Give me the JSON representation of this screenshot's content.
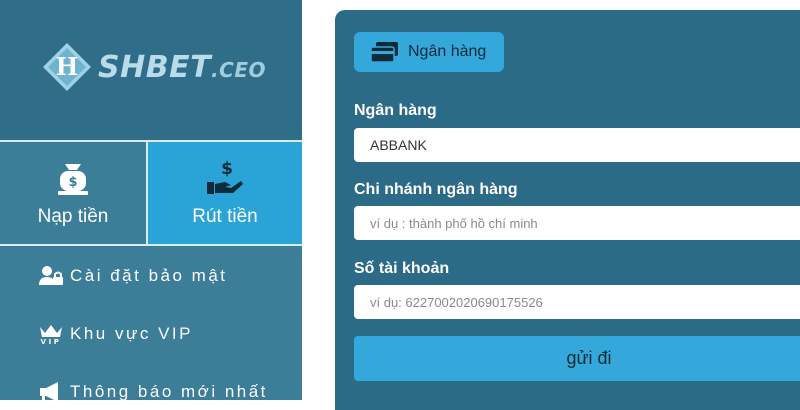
{
  "brand": {
    "logo_letter": "H",
    "name": "SHBET",
    "suffix": ".CEO"
  },
  "actions": [
    {
      "label": "Nạp tiền",
      "icon": "money-bag-icon"
    },
    {
      "label": "Rút tiền",
      "icon": "hand-dollar-icon"
    }
  ],
  "menu": [
    {
      "label": "Cài đặt bảo mật",
      "icon": "user-lock-icon"
    },
    {
      "label": "Khu vực VIP",
      "icon": "vip-crown-icon"
    },
    {
      "label": "Thông báo mới nhất",
      "icon": "megaphone-icon"
    }
  ],
  "form": {
    "tab_label": "Ngân hàng",
    "bank_label": "Ngân hàng",
    "bank_value": "ABBANK",
    "branch_label": "Chi nhánh ngân hàng",
    "branch_placeholder": "ví dụ : thành phố hồ chí minh",
    "account_label": "Số tài khoản",
    "account_placeholder": "ví dụ:  6227002020690175526",
    "submit_label": "gửi đi"
  },
  "colors": {
    "sidebar": "#3c7d98",
    "logo_bg": "#2f6d89",
    "active": "#2aa3d6",
    "panel": "#2c6b87",
    "accent": "#34a8db"
  }
}
